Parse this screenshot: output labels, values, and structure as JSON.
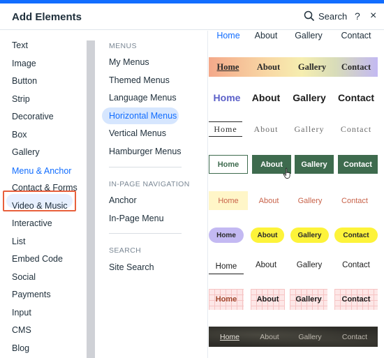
{
  "header": {
    "title": "Add Elements",
    "search_label": "Search",
    "help_label": "?",
    "close_label": "×"
  },
  "categories": [
    "Text",
    "Image",
    "Button",
    "Strip",
    "Decorative",
    "Box",
    "Gallery",
    "Menu & Anchor",
    "Contact & Forms",
    "Video & Music",
    "Interactive",
    "List",
    "Embed Code",
    "Social",
    "Payments",
    "Input",
    "CMS",
    "Blog"
  ],
  "active_category": "Menu & Anchor",
  "sections": {
    "menus": {
      "heading": "MENUS",
      "items": [
        "My Menus",
        "Themed Menus",
        "Language Menus",
        "Horizontal Menus",
        "Vertical Menus",
        "Hamburger Menus"
      ]
    },
    "in_page": {
      "heading": "IN-PAGE NAVIGATION",
      "items": [
        "Anchor",
        "In-Page Menu"
      ]
    },
    "search": {
      "heading": "SEARCH",
      "items": [
        "Site Search"
      ]
    }
  },
  "active_subcategory": "Horizontal Menus",
  "menu_previews": [
    [
      "Home",
      "About",
      "Gallery",
      "Contact"
    ],
    [
      "Home",
      "About",
      "Gallery",
      "Contact"
    ],
    [
      "Home",
      "About",
      "Gallery",
      "Contact"
    ],
    [
      "Home",
      "About",
      "Gallery",
      "Contact"
    ],
    [
      "Home",
      "About",
      "Gallery",
      "Contact"
    ],
    [
      "Home",
      "About",
      "Gallery",
      "Contact"
    ],
    [
      "Home",
      "About",
      "Gallery",
      "Contact"
    ],
    [
      "Home",
      "About",
      "Gallery",
      "Contact"
    ],
    [
      "Home",
      "About",
      "Gallery",
      "Contact"
    ],
    [
      "Home",
      "About",
      "Gallery",
      "Contact"
    ]
  ],
  "colors": {
    "accent": "#116dff",
    "active_outline": "#e8603c",
    "green": "#3e6b4e",
    "yellow": "#fdf33a",
    "lavender": "#c3b9f2"
  }
}
